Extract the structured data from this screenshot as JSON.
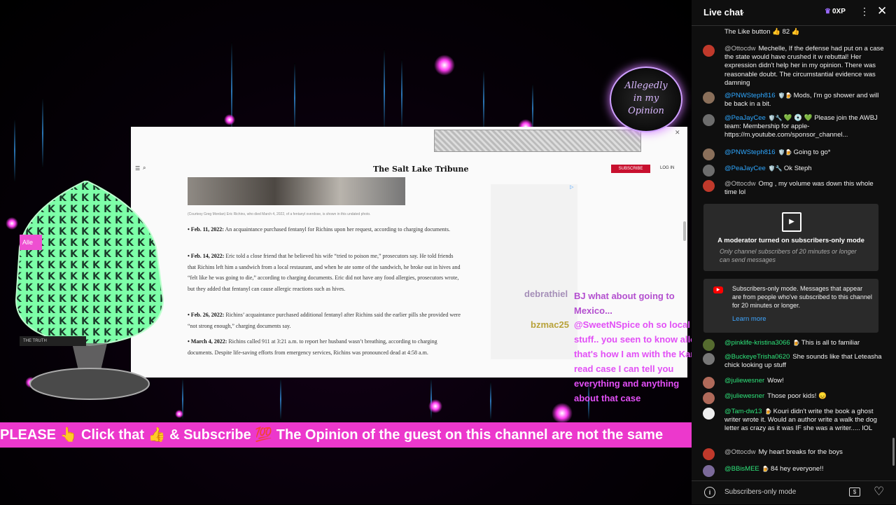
{
  "article": {
    "masthead": "The Salt Lake Tribune",
    "subscribe": "SUBSCRIBE",
    "login": "LOG IN",
    "caption": "(Courtesy Greg Mordan) Eric Richins, who died March 4, 2022, of a fentanyl overdose, is shown in this undated photo.",
    "paragraphs": [
      {
        "date": "• Feb. 11, 2022:",
        "text": " An acquaintance purchased fentanyl for Richins upon her request, according to charging documents."
      },
      {
        "date": "• Feb. 14, 2022:",
        "text": " Eric told a close friend that he believed his wife “tried to poison me,” prosecutors say. He told friends that Richins left him a sandwich from a local restaurant, and when he ate some of the sandwich, he broke out in hives and “felt like he was going to die,” according to charging documents. Eric did not have any food allergies, prosecutors wrote, but they added that fentanyl can cause allergic reactions such as hives."
      },
      {
        "date": "• Feb. 26, 2022:",
        "text": " Richins’ acquaintance purchased additional fentanyl after Richins said the earlier pills she provided were “not strong enough,” charging documents say."
      },
      {
        "date": "• March 4, 2022:",
        "text": " Richins called 911 at 3:21 a.m. to report her husband wasn’t breathing, according to charging documents. Despite life-saving efforts from emergency services, Richins was pronounced dead at 4:58 a.m."
      }
    ]
  },
  "logo": {
    "line1": "Allegedly",
    "line2": "in my",
    "line3": "Opinion"
  },
  "overlay": {
    "name1": "debrathiel",
    "msg1": "BJ what about going to Mexico...",
    "name2": "bzmac25",
    "msg2": "@SweetNSpice oh so local stuff.. you seen to know allot! that's how I am with the Karen read case I can tell you everything and anything about that case"
  },
  "tags": {
    "allegedly": "Alle",
    "truth": "THE TRUTH"
  },
  "ticker": "PLEASE 👆 Click that 👍 & Subscribe 💯 The Opinion of the guest on this channel are not the same",
  "chat": {
    "title": "Live chat",
    "xp": "0XP",
    "like_line": "The Like button 👍 82 👍",
    "messages": [
      {
        "author": "@Ottocdw",
        "text": "Mechelle, If the defense had put on a case the state would have crushed it w rebuttal! Her expression didn't help her in my opinion. There was reasonable doubt. The circumstantial evidence was damning",
        "color": "#c0392b",
        "initial": "O"
      },
      {
        "author": "@PNWSteph816",
        "text": "Mods, I'm go shower and will be back in a bit.",
        "color": "#8a6f5a",
        "initial": ""
      },
      {
        "author": "@PeaJayCee",
        "text": "💚 💿 💚 Please join the AWBJ team: Membership for apple- https://m.youtube.com/sponsor_channel...",
        "color": "#6d6d6d",
        "initial": ""
      },
      {
        "author": "@PNWSteph816",
        "text": "Going to go*",
        "color": "#8a6f5a",
        "initial": ""
      },
      {
        "author": "@PeaJayCee",
        "text": "Ok Steph",
        "color": "#6d6d6d",
        "initial": ""
      },
      {
        "author": "@Ottocdw",
        "text": "Omg , my volume was down this whole time lol",
        "color": "#c0392b",
        "initial": "O"
      }
    ],
    "notice1": {
      "title": "A moderator turned on subscribers-only mode",
      "sub": "Only channel subscribers of 20 minutes or longer can send messages"
    },
    "notice2": {
      "text": "Subscribers-only mode. Messages that appear are from people who've subscribed to this channel for 20 minutes or longer.",
      "link": "Learn more"
    },
    "messages2": [
      {
        "author": "@pinklife-kristina3066",
        "text": "This is all to familiar",
        "color": "#556b2f"
      },
      {
        "author": "@BuckeyeTrisha0620",
        "text": "She sounds like that Leteasha chick looking up stuff",
        "color": "#777"
      },
      {
        "author": "@juliewesner",
        "text": "Wow!",
        "color": "#b06a5a"
      },
      {
        "author": "@juliewesner",
        "text": "Those poor kids! 😞",
        "color": "#b06a5a"
      },
      {
        "author": "@Tam-dw13",
        "text": "Kouri didn't write the book a ghost writer wrote it. Would an author write a walk the dog letter as crazy as it was IF she was a writer..... lOL",
        "color": "#eee"
      },
      {
        "author": "@Ottocdw",
        "text": "My heart breaks for the boys",
        "color": "#c0392b",
        "initial": "O"
      },
      {
        "author": "@BBisMEE",
        "text": "84 hey everyone!!",
        "color": "#7b6a9a"
      }
    ],
    "input_placeholder": "Subscribers-only mode"
  }
}
